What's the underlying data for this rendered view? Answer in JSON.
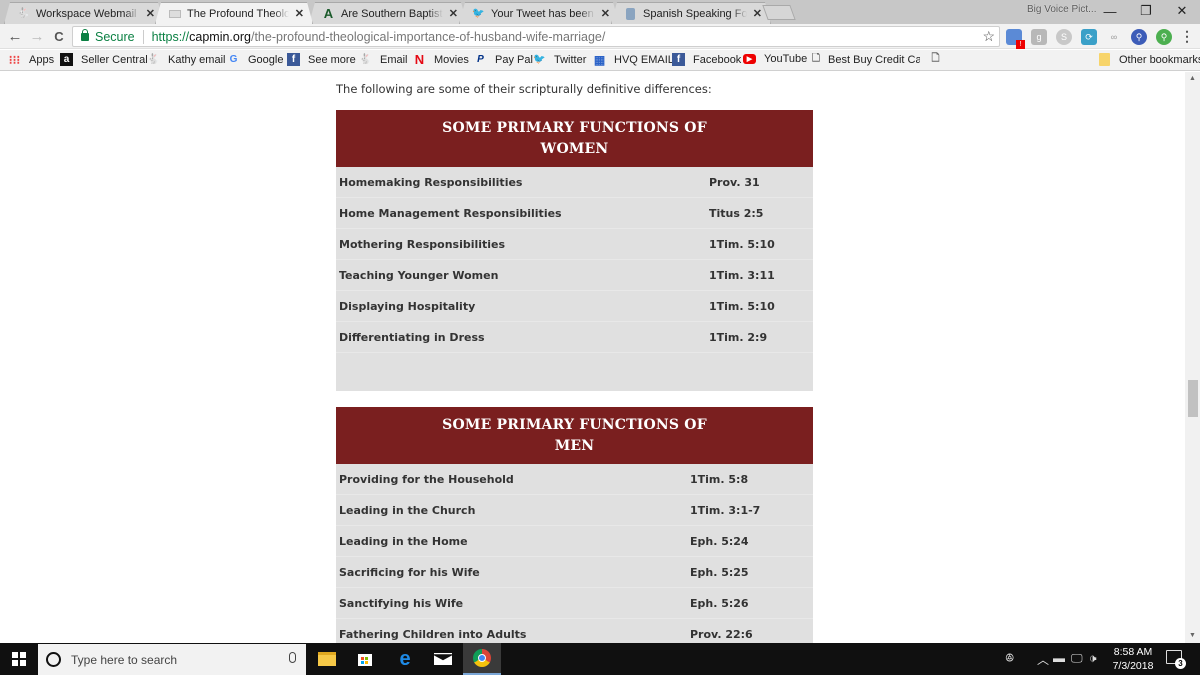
{
  "browser": {
    "tabs": [
      {
        "label": "Workspace Webmail :: Ma",
        "icon": "mail-favicon",
        "active": false
      },
      {
        "label": "The Profound Theologica",
        "icon": "page-favicon",
        "active": true
      },
      {
        "label": "Are Southern Baptists Tu",
        "icon": "bible-favicon",
        "active": false
      },
      {
        "label": "Your Tweet has been pos",
        "icon": "twitter-favicon",
        "active": false
      },
      {
        "label": "Spanish Speaking Forens",
        "icon": "site-favicon",
        "active": false
      }
    ],
    "close_glyph": "✕",
    "window_title": "Big Voice Pict...",
    "window_controls": {
      "minimize": "—",
      "maximize": "❐",
      "close": "✕"
    },
    "nav": {
      "back": "←",
      "forward": "→",
      "reload": "C"
    },
    "address": {
      "secure_label": "Secure",
      "scheme": "https://",
      "host": "capmin.org",
      "path": "/the-profound-theological-importance-of-husband-wife-marriage/"
    },
    "star_glyph": "☆",
    "menu_glyph": "⋮",
    "extensions": [
      {
        "name": "calendar-extension",
        "badge": "!"
      },
      {
        "name": "google-plus-extension"
      },
      {
        "name": "skype-extension"
      },
      {
        "name": "sync-extension"
      },
      {
        "name": "link-extension"
      },
      {
        "name": "search-extension"
      },
      {
        "name": "zoom-extension"
      }
    ],
    "bookmarks": [
      {
        "label": "Apps",
        "icon": "apps-grid-icon"
      },
      {
        "label": "Seller Central",
        "icon": "amazon-icon"
      },
      {
        "label": "Kathy email",
        "icon": "mail-favicon"
      },
      {
        "label": "Google",
        "icon": "google-icon"
      },
      {
        "label": "See more",
        "icon": "facebook-icon"
      },
      {
        "label": "Email",
        "icon": "mail-favicon"
      },
      {
        "label": "Movies",
        "icon": "netflix-icon"
      },
      {
        "label": "Pay Pal",
        "icon": "paypal-icon"
      },
      {
        "label": "Twitter",
        "icon": "twitter-icon"
      },
      {
        "label": "HVQ EMAIL",
        "icon": "grid-icon"
      },
      {
        "label": "Facebook",
        "icon": "facebook-icon"
      },
      {
        "label": "YouTube",
        "icon": "youtube-icon"
      },
      {
        "label": "Best Buy Credit Card",
        "icon": "page-icon"
      },
      {
        "label": "",
        "icon": "page-icon"
      }
    ],
    "other_bookmarks": "Other bookmarks"
  },
  "page": {
    "intro": "The following are some of their scripturally definitive differences:",
    "women_table": {
      "title_line1": "SOME PRIMARY FUNCTIONS OF",
      "title_line2": "WOMEN",
      "rows": [
        {
          "function": "Homemaking Responsibilities",
          "reference": "Prov. 31"
        },
        {
          "function": "Home Management Responsibilities",
          "reference": "Titus 2:5"
        },
        {
          "function": "Mothering Responsibilities",
          "reference": "1Tim. 5:10"
        },
        {
          "function": "Teaching Younger Women",
          "reference": "1Tim. 3:11"
        },
        {
          "function": "Displaying Hospitality",
          "reference": "1Tim. 5:10"
        },
        {
          "function": "Differentiating in Dress",
          "reference": "1Tim. 2:9"
        }
      ]
    },
    "men_table": {
      "title_line1": "SOME PRIMARY FUNCTIONS OF",
      "title_line2": "MEN",
      "rows": [
        {
          "function": "Providing for the Household",
          "reference": "1Tim. 5:8"
        },
        {
          "function": "Leading in the Church",
          "reference": "1Tim. 3:1-7"
        },
        {
          "function": "Leading in the Home",
          "reference": "Eph. 5:24"
        },
        {
          "function": "Sacrificing for his Wife",
          "reference": "Eph. 5:25"
        },
        {
          "function": "Sanctifying his Wife",
          "reference": "Eph. 5:26"
        },
        {
          "function": "Fathering Children into Adults",
          "reference": "Prov. 22:6"
        }
      ]
    }
  },
  "taskbar": {
    "search_placeholder": "Type here to search",
    "pinned": [
      "file-explorer",
      "store",
      "edge",
      "mail",
      "chrome"
    ],
    "clock_time": "8:58 AM",
    "clock_date": "7/3/2018",
    "notification_count": "3"
  },
  "colors": {
    "table_header": "#7a1f1f",
    "table_body": "#e0e0e0",
    "secure_green": "#0b8043"
  }
}
